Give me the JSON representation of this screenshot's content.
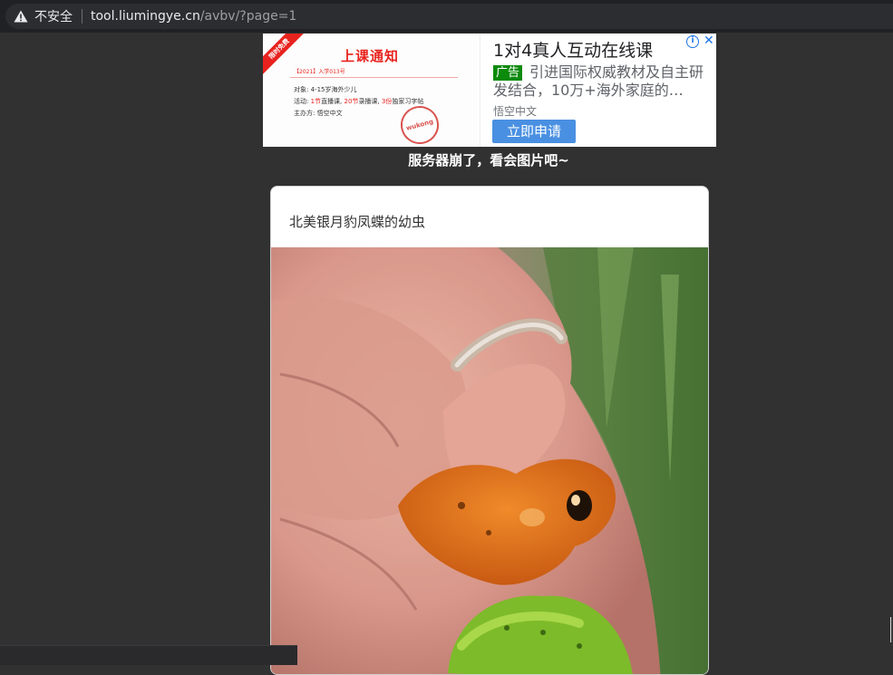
{
  "address_bar": {
    "security_label": "不安全",
    "url_host": "tool.liumingye.cn",
    "url_path": "/avbv/?page=1",
    "warning_icon": "warning-triangle-icon"
  },
  "ad": {
    "image": {
      "ribbon": "限时免费",
      "title": "上课通知",
      "date": "【2021】入学013号",
      "line1": "对象: 4-15岁海外少儿",
      "line2_pre": "活动: ",
      "line2_a": "1节",
      "line2_b": "直播课, ",
      "line2_c": "20节",
      "line2_d": "录播课, ",
      "line2_e": "3份",
      "line2_f": "独家习字帖",
      "line3": "主办方: 悟空中文",
      "stamp": "wukong"
    },
    "title": "1对4真人互动在线课",
    "badge": "广告",
    "description": "引进国际权威教材及自主研发结合，10万+海外家庭的…",
    "source": "悟空中文",
    "cta": "立即申请",
    "info_icon": "info-icon",
    "close_icon": "close-icon"
  },
  "notice": "服务器崩了，看会图片吧~",
  "card": {
    "title": "北美银月豹凤蝶的幼虫"
  },
  "colors": {
    "page_bg": "#313131",
    "addr_bg": "#202124",
    "ad_badge": "#0b8a0b",
    "cta": "#4a90e2",
    "ad_red": "#e8231f"
  }
}
